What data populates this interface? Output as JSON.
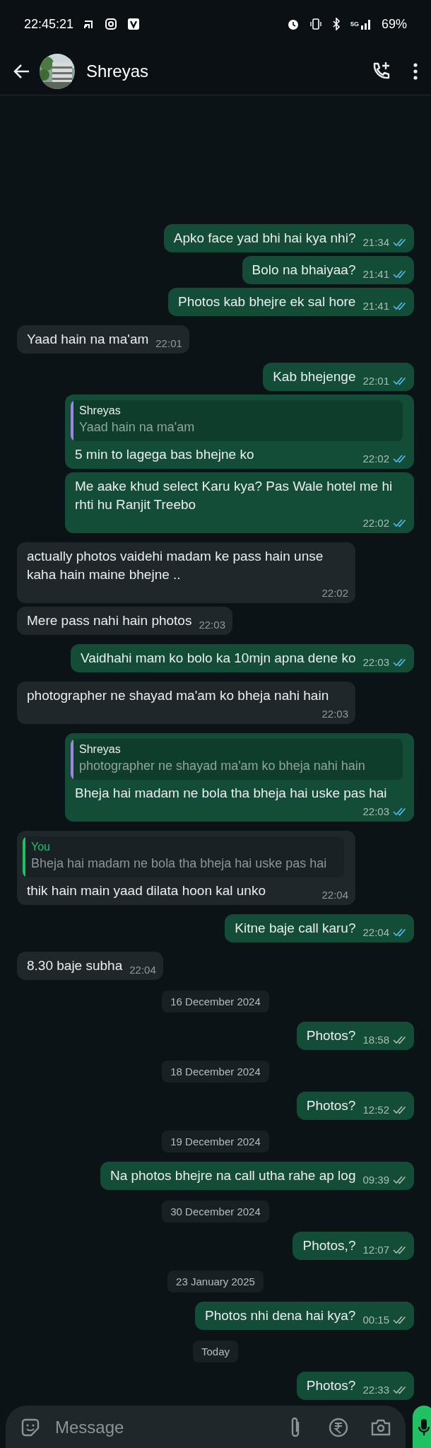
{
  "status_bar": {
    "time": "22:45:21",
    "battery": "69%",
    "network": "5G"
  },
  "header": {
    "name": "Shreyas"
  },
  "messages": [
    {
      "kind": "message",
      "outgoing": true,
      "text": "Apko face yad bhi hai kya nhi?",
      "time": "21:34",
      "read": true
    },
    {
      "kind": "message",
      "outgoing": true,
      "text": "Bolo na bhaiyaa?",
      "time": "21:41",
      "read": true
    },
    {
      "kind": "message",
      "outgoing": true,
      "text": "Photos kab bhejre ek sal hore",
      "time": "21:41",
      "read": true
    },
    {
      "kind": "message",
      "outgoing": false,
      "text": "Yaad hain na ma'am",
      "time": "22:01"
    },
    {
      "kind": "message",
      "outgoing": true,
      "text": "Kab bhejenge",
      "time": "22:01",
      "read": true
    },
    {
      "kind": "message",
      "outgoing": true,
      "text": "5 min to lagega bas bhejne ko",
      "time": "22:02",
      "read": true,
      "quote": {
        "author": "Shreyas",
        "text": "Yaad hain na ma'am",
        "color": "#a183e8"
      }
    },
    {
      "kind": "message",
      "outgoing": true,
      "text": "Me aake khud select Karu kya? Pas Wale hotel me hi rhti hu Ranjit Treebo",
      "time": "22:02",
      "read": true
    },
    {
      "kind": "message",
      "outgoing": false,
      "text": "actually photos vaidehi madam ke pass hain unse kaha hain maine bhejne ..",
      "time": "22:02"
    },
    {
      "kind": "message",
      "outgoing": false,
      "text": "Mere pass nahi hain photos",
      "time": "22:03"
    },
    {
      "kind": "message",
      "outgoing": true,
      "text": "Vaidhahi mam ko bolo ka 10mjn apna dene ko",
      "time": "22:03",
      "read": true
    },
    {
      "kind": "message",
      "outgoing": false,
      "text": "photographer ne shayad ma'am ko bheja nahi hain",
      "time": "22:03"
    },
    {
      "kind": "message",
      "outgoing": true,
      "text": "Bheja hai madam ne bola tha bheja hai uske pas hai",
      "time": "22:03",
      "read": true,
      "quote": {
        "author": "Shreyas",
        "text": "photographer ne shayad ma'am ko bheja nahi hain",
        "color": "#a183e8"
      }
    },
    {
      "kind": "message",
      "outgoing": false,
      "text": "thik hain main yaad dilata hoon kal unko",
      "time": "22:04",
      "quote": {
        "author": "You",
        "text": "Bheja hai madam ne bola tha bheja hai uske pas hai",
        "color": "#21c063"
      }
    },
    {
      "kind": "message",
      "outgoing": true,
      "text": "Kitne baje call karu?",
      "time": "22:04",
      "read": true
    },
    {
      "kind": "message",
      "outgoing": false,
      "text": "8.30 baje subha",
      "time": "22:04"
    },
    {
      "kind": "date",
      "text": "16 December 2024"
    },
    {
      "kind": "message",
      "outgoing": true,
      "text": "Photos?",
      "time": "18:58",
      "read": false
    },
    {
      "kind": "date",
      "text": "18 December 2024"
    },
    {
      "kind": "message",
      "outgoing": true,
      "text": "Photos?",
      "time": "12:52",
      "read": false
    },
    {
      "kind": "date",
      "text": "19 December 2024"
    },
    {
      "kind": "message",
      "outgoing": true,
      "text": "Na photos bhejre na call utha rahe ap log",
      "time": "09:39",
      "read": false
    },
    {
      "kind": "date",
      "text": "30 December 2024"
    },
    {
      "kind": "message",
      "outgoing": true,
      "text": "Photos,?",
      "time": "12:07",
      "read": false
    },
    {
      "kind": "date",
      "text": "23 January 2025"
    },
    {
      "kind": "message",
      "outgoing": true,
      "text": "Photos nhi dena hai kya?",
      "time": "00:15",
      "read": false
    },
    {
      "kind": "date",
      "text": "Today"
    },
    {
      "kind": "message",
      "outgoing": true,
      "text": "Photos?",
      "time": "22:33",
      "read": false
    }
  ],
  "composer": {
    "placeholder": "Message"
  }
}
